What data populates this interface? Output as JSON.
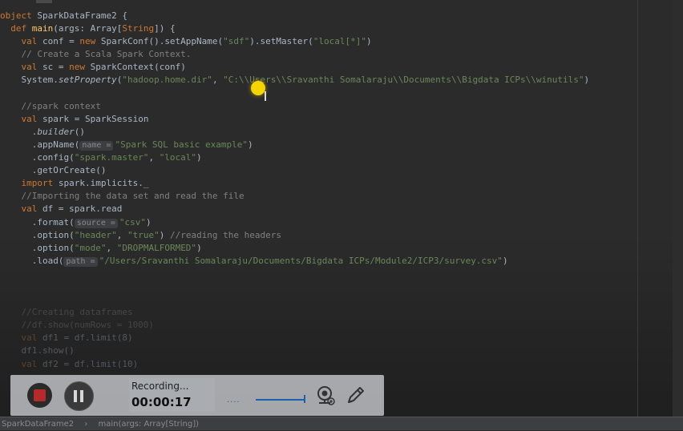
{
  "code_lines": [
    {
      "parts": [
        [
          "kw",
          "object "
        ],
        [
          "plain",
          "SparkDataFrame2 {"
        ]
      ]
    },
    {
      "parts": [
        [
          "kw",
          "  def "
        ],
        [
          "fn",
          "main"
        ],
        [
          "plain",
          "(args: Array["
        ],
        [
          "kw",
          "String"
        ],
        [
          "plain",
          "]) {"
        ]
      ]
    },
    {
      "parts": [
        [
          "kw",
          "    val "
        ],
        [
          "plain",
          "conf = "
        ],
        [
          "kw",
          "new "
        ],
        [
          "plain",
          "SparkConf().setAppName("
        ],
        [
          "str",
          "\"sdf\""
        ],
        [
          "plain",
          ").setMaster("
        ],
        [
          "str",
          "\"local[*]\""
        ],
        [
          "plain",
          ")"
        ]
      ]
    },
    {
      "parts": [
        [
          "cmt",
          "    // Create a Scala Spark Context."
        ]
      ]
    },
    {
      "parts": [
        [
          "kw",
          "    val "
        ],
        [
          "plain",
          "sc = "
        ],
        [
          "kw",
          "new "
        ],
        [
          "plain",
          "SparkContext(conf)"
        ]
      ]
    },
    {
      "parts": [
        [
          "plain",
          "    System."
        ],
        [
          "ital",
          "setProperty"
        ],
        [
          "plain",
          "("
        ],
        [
          "str",
          "\"hadoop.home.dir\""
        ],
        [
          "plain",
          ", "
        ],
        [
          "str",
          "\"C:\\\\Users\\\\Sravanthi Somalaraju\\\\Documents\\\\Bigdata ICPs\\\\winutils\""
        ],
        [
          "plain",
          ")"
        ]
      ]
    },
    {
      "parts": [
        [
          "plain",
          ""
        ]
      ]
    },
    {
      "parts": [
        [
          "cmt",
          "    //spark context"
        ]
      ]
    },
    {
      "parts": [
        [
          "kw",
          "    val "
        ],
        [
          "plain",
          "spark = SparkSession"
        ]
      ]
    },
    {
      "parts": [
        [
          "plain",
          "      ."
        ],
        [
          "ital",
          "builder"
        ],
        [
          "plain",
          "()"
        ]
      ]
    },
    {
      "parts": [
        [
          "plain",
          "      .appName("
        ],
        [
          "hint",
          "name ="
        ],
        [
          "str",
          "\"Spark SQL basic example\""
        ],
        [
          "plain",
          ")"
        ]
      ]
    },
    {
      "parts": [
        [
          "plain",
          "      .config("
        ],
        [
          "str",
          "\"spark.master\""
        ],
        [
          "plain",
          ", "
        ],
        [
          "str",
          "\"local\""
        ],
        [
          "plain",
          ")"
        ]
      ]
    },
    {
      "parts": [
        [
          "plain",
          "      .getOrCreate()"
        ]
      ]
    },
    {
      "parts": [
        [
          "kw",
          "    import "
        ],
        [
          "plain",
          "spark.implicits._"
        ]
      ]
    },
    {
      "parts": [
        [
          "cmt",
          "    //Importing the data set and read the file"
        ]
      ]
    },
    {
      "parts": [
        [
          "kw",
          "    val "
        ],
        [
          "plain",
          "df = spark.read"
        ]
      ]
    },
    {
      "parts": [
        [
          "plain",
          "      .format("
        ],
        [
          "hint",
          "source ="
        ],
        [
          "str",
          "\"csv\""
        ],
        [
          "plain",
          ")"
        ]
      ]
    },
    {
      "parts": [
        [
          "plain",
          "      .option("
        ],
        [
          "str",
          "\"header\""
        ],
        [
          "plain",
          ", "
        ],
        [
          "str",
          "\"true\""
        ],
        [
          "plain",
          ") "
        ],
        [
          "cmt",
          "//reading the headers"
        ]
      ]
    },
    {
      "parts": [
        [
          "plain",
          "      .option("
        ],
        [
          "str",
          "\"mode\""
        ],
        [
          "plain",
          ", "
        ],
        [
          "str",
          "\"DROPMALFORMED\""
        ],
        [
          "plain",
          ")"
        ]
      ]
    },
    {
      "parts": [
        [
          "plain",
          "      .load("
        ],
        [
          "hint",
          "path ="
        ],
        [
          "str",
          "\"/Users/Sravanthi Somalaraju/Documents/Bigdata ICPs/Module2/ICP3/survey.csv\""
        ],
        [
          "plain",
          ")"
        ]
      ]
    },
    {
      "parts": [
        [
          "plain",
          ""
        ]
      ]
    },
    {
      "parts": [
        [
          "plain",
          ""
        ]
      ]
    },
    {
      "parts": [
        [
          "plain",
          ""
        ]
      ]
    },
    {
      "parts": [
        [
          "cmt",
          "    //Creating dataframes"
        ]
      ]
    },
    {
      "parts": [
        [
          "cmt",
          "    //df.show(numRows = 1000)"
        ]
      ]
    },
    {
      "parts": [
        [
          "kw",
          "    val "
        ],
        [
          "plain",
          "df1 = df.limit(8)"
        ]
      ]
    },
    {
      "parts": [
        [
          "plain",
          "    df1.show()"
        ]
      ]
    },
    {
      "parts": [
        [
          "kw",
          "    val "
        ],
        [
          "plain",
          "df2 = df.limit(10)"
        ]
      ]
    }
  ],
  "statusbar": {
    "crumb1": "SparkDataFrame2",
    "sep": "›",
    "crumb2": "main(args: Array[String])"
  },
  "recorder": {
    "label": "Recording...",
    "time": "00:00:17",
    "dots": "....",
    "stop_icon": "stop-icon",
    "pause_icon": "pause-icon",
    "webcam_icon": "webcam-icon",
    "pen_icon": "pen-icon",
    "stop_color": "#b52a2a",
    "accent": "#1b5fb0"
  },
  "colors": {
    "keyword": "#cc7832",
    "string": "#6a8759",
    "comment": "#808080",
    "cursor_highlight": "#f5d400"
  }
}
